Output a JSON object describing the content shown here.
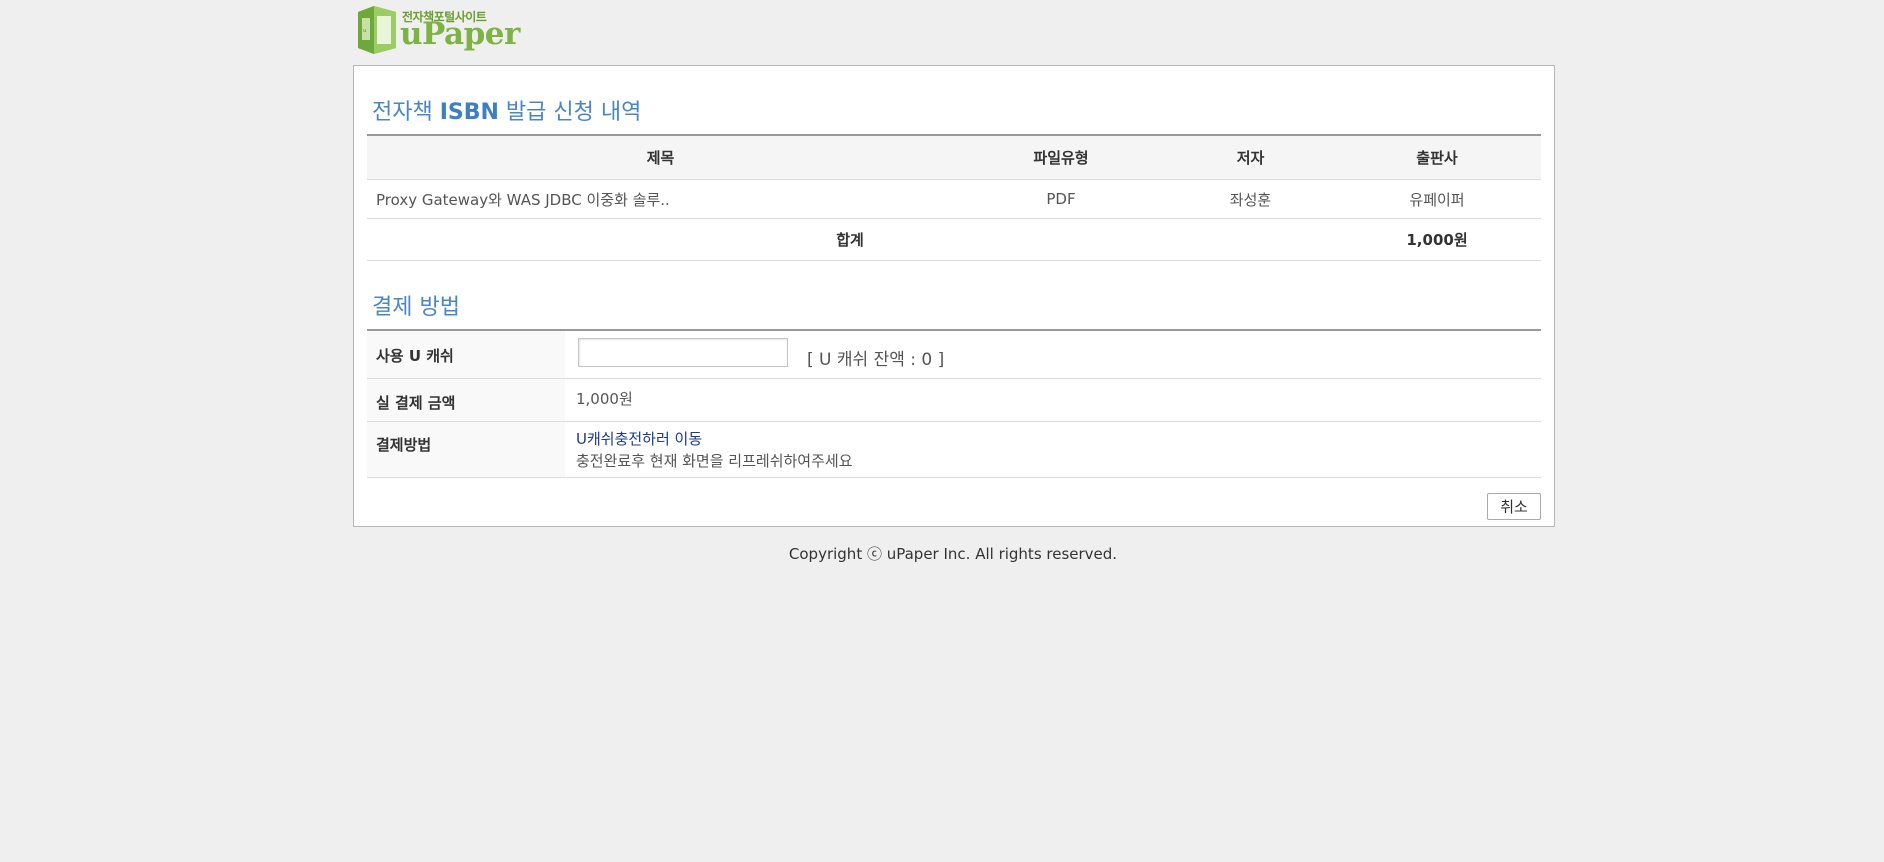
{
  "logo": {
    "subtitle": "전자책포털사이트",
    "name": "uPaper"
  },
  "isbn_section": {
    "title_prefix": "전자책 ",
    "title_bold": "ISBN",
    "title_suffix": " 발급 신청 내역",
    "columns": [
      "제목",
      "파일유형",
      "저자",
      "출판사"
    ],
    "rows": [
      {
        "title": "Proxy Gateway와 WAS JDBC 이중화 솔루..",
        "file_type": "PDF",
        "author": "좌성훈",
        "publisher": "유페이퍼"
      }
    ],
    "total_label": "합계",
    "total_value": "1,000원"
  },
  "payment_section": {
    "title": "결제 방법",
    "use_cash_label": "사용 U 캐쉬",
    "use_cash_value": "",
    "cash_balance": "[ U 캐쉬 잔액 : 0 ]",
    "actual_amount_label": "실 결제 금액",
    "actual_amount_value": "1,000원",
    "method_label": "결제방법",
    "charge_link": "U캐쉬충전하러 이동",
    "charge_note": "충전완료후 현재 화면을 리프레쉬하여주세요"
  },
  "buttons": {
    "cancel": "취소"
  },
  "footer": {
    "copyright": "Copyright ⓒ uPaper Inc. All rights reserved."
  },
  "colors": {
    "accent": "#4a86c5",
    "logo_green": "#7cb342",
    "link": "#1a3a8a",
    "page_bg": "#efefef"
  }
}
